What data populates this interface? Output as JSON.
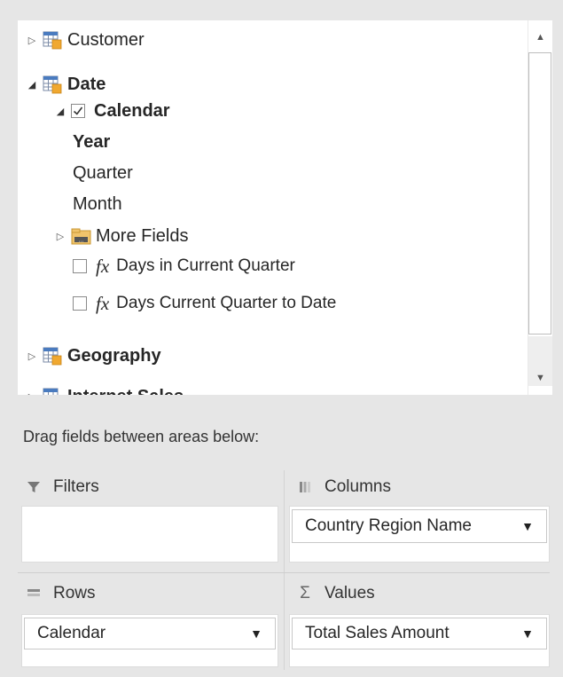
{
  "field_list": {
    "tables": [
      {
        "name": "Customer",
        "expanded": false
      },
      {
        "name": "Date",
        "expanded": true
      },
      {
        "name": "Geography",
        "expanded": false
      },
      {
        "name": "Internet Sales",
        "expanded": false
      }
    ],
    "date_children": {
      "hierarchy": {
        "name": "Calendar",
        "checked": true
      },
      "levels": [
        "Year",
        "Quarter",
        "Month"
      ],
      "more_fields": "More Fields",
      "measures": [
        {
          "name": "Days in Current Quarter",
          "checked": false
        },
        {
          "name": "Days Current Quarter to Date",
          "checked": false
        }
      ],
      "fx_glyph": "fx"
    }
  },
  "drag_hint": "Drag fields between areas below:",
  "areas": {
    "filters": {
      "label": "Filters",
      "icon": "filter-icon",
      "items": []
    },
    "columns": {
      "label": "Columns",
      "icon": "columns-icon",
      "items": [
        "Country Region Name"
      ]
    },
    "rows": {
      "label": "Rows",
      "icon": "rows-icon",
      "items": [
        "Calendar"
      ]
    },
    "values": {
      "label": "Values",
      "icon": "sigma-icon",
      "glyph": "Σ",
      "items": [
        "Total Sales Amount"
      ]
    }
  },
  "colors": {
    "panel_bg": "#e6e6e6",
    "list_bg": "#ffffff",
    "table_icon_grid": "#4a7bbf",
    "table_icon_accent": "#f0a830"
  }
}
